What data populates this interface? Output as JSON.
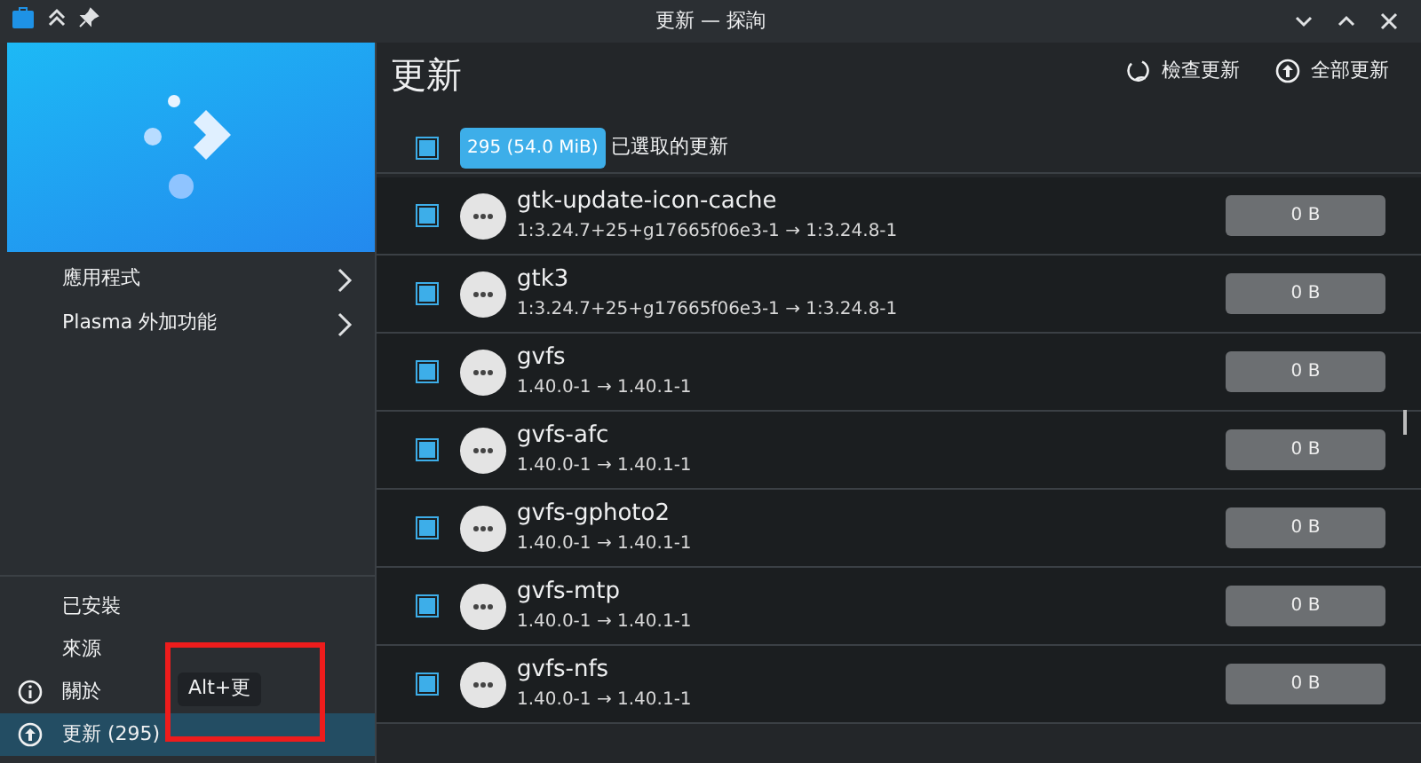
{
  "window": {
    "title": "更新 — 探詢"
  },
  "sidebar": {
    "categories": [
      {
        "label": "應用程式"
      },
      {
        "label": "Plasma 外加功能"
      }
    ],
    "items": [
      {
        "label": "已安裝",
        "kind": "plain",
        "selected": false
      },
      {
        "label": "來源",
        "kind": "plain",
        "selected": false
      },
      {
        "label": "關於",
        "kind": "info",
        "selected": false
      },
      {
        "label": "更新 (295)",
        "kind": "update",
        "selected": true
      }
    ],
    "tooltip": "Alt+更"
  },
  "header": {
    "title": "更新",
    "actions": [
      {
        "label": "檢查更新",
        "kind": "refresh"
      },
      {
        "label": "全部更新",
        "kind": "upgrade"
      }
    ]
  },
  "selection": {
    "checked": true,
    "badge": "295 (54.0 MiB)",
    "label": "已選取的更新"
  },
  "updates": [
    {
      "name": "gtk-update-icon-cache",
      "version": "1:3.24.7+25+g17665f06e3-1 → 1:3.24.8-1",
      "size": "0 B",
      "checked": true
    },
    {
      "name": "gtk3",
      "version": "1:3.24.7+25+g17665f06e3-1 → 1:3.24.8-1",
      "size": "0 B",
      "checked": true
    },
    {
      "name": "gvfs",
      "version": "1.40.0-1 → 1.40.1-1",
      "size": "0 B",
      "checked": true
    },
    {
      "name": "gvfs-afc",
      "version": "1.40.0-1 → 1.40.1-1",
      "size": "0 B",
      "checked": true
    },
    {
      "name": "gvfs-gphoto2",
      "version": "1.40.0-1 → 1.40.1-1",
      "size": "0 B",
      "checked": true
    },
    {
      "name": "gvfs-mtp",
      "version": "1.40.0-1 → 1.40.1-1",
      "size": "0 B",
      "checked": true
    },
    {
      "name": "gvfs-nfs",
      "version": "1.40.0-1 → 1.40.1-1",
      "size": "0 B",
      "checked": true
    }
  ]
}
